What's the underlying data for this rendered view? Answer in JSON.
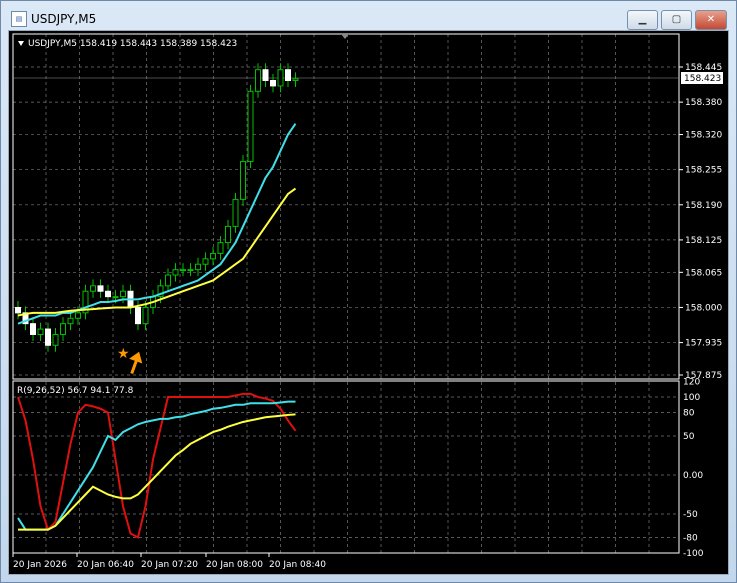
{
  "window": {
    "title": "USDJPY,M5",
    "buttons": [
      "minimize",
      "maximize",
      "close"
    ]
  },
  "chart_header": "USDJPY,M5  158.419 158.443 158.389 158.423",
  "current_price": "158.423",
  "price_axis": [
    "158.445",
    "158.380",
    "158.320",
    "158.255",
    "158.190",
    "158.125",
    "158.065",
    "158.000",
    "157.935",
    "157.875"
  ],
  "indicator": {
    "label": "R(9,26,52) 56.7 94.1 77.8",
    "axis": [
      "120",
      "100",
      "80",
      "50",
      "0.00",
      "-50",
      "-80",
      "-100"
    ]
  },
  "time_axis": [
    "20 Jan 2026",
    "20 Jan 06:40",
    "20 Jan 07:20",
    "20 Jan 08:00",
    "20 Jan 08:40"
  ],
  "colors": {
    "bull": "#00c000",
    "bear": "#ffffff",
    "ma_fast": "#40e0e8",
    "ma_slow": "#ffff40",
    "ind_red": "#e01010",
    "signal": "#ff9900"
  },
  "chart_data": {
    "type": "candlestick",
    "closes": [
      157.99,
      157.97,
      157.95,
      157.96,
      157.93,
      157.95,
      157.97,
      157.98,
      157.99,
      158.03,
      158.04,
      158.03,
      158.02,
      158.02,
      158.03,
      158.0,
      157.97,
      158.0,
      158.02,
      158.04,
      158.06,
      158.07,
      158.07,
      158.07,
      158.08,
      158.09,
      158.1,
      158.12,
      158.15,
      158.2,
      158.27,
      158.4,
      158.44,
      158.42,
      158.41,
      158.44,
      158.42,
      158.423
    ],
    "ma_fast": [
      157.97,
      157.975,
      157.98,
      157.985,
      157.985,
      157.985,
      157.99,
      157.99,
      157.995,
      158.0,
      158.005,
      158.01,
      158.01,
      158.012,
      158.015,
      158.015,
      158.015,
      158.018,
      158.02,
      158.025,
      158.03,
      158.035,
      158.04,
      158.045,
      158.05,
      158.06,
      158.07,
      158.08,
      158.1,
      158.12,
      158.15,
      158.18,
      158.21,
      158.24,
      158.26,
      158.29,
      158.32,
      158.34
    ],
    "ma_slow": [
      157.985,
      157.988,
      157.99,
      157.99,
      157.99,
      157.99,
      157.992,
      157.994,
      157.995,
      157.996,
      157.997,
      157.998,
      157.999,
      158.0,
      158.0,
      158.0,
      158.003,
      158.006,
      158.01,
      158.015,
      158.02,
      158.025,
      158.03,
      158.035,
      158.04,
      158.045,
      158.05,
      158.06,
      158.07,
      158.08,
      158.09,
      158.11,
      158.13,
      158.15,
      158.17,
      158.19,
      158.21,
      158.22
    ],
    "ind_red": [
      100,
      70,
      20,
      -40,
      -70,
      -60,
      -10,
      40,
      80,
      90,
      88,
      85,
      80,
      20,
      -40,
      -75,
      -80,
      -40,
      20,
      60,
      100,
      100,
      100,
      100,
      100,
      100,
      100,
      100,
      100,
      102,
      104,
      104,
      100,
      98,
      95,
      85,
      70,
      56.7
    ],
    "ind_cyan": [
      -55,
      -70,
      -70,
      -70,
      -70,
      -65,
      -50,
      -35,
      -20,
      -5,
      10,
      30,
      50,
      45,
      55,
      60,
      65,
      68,
      70,
      72,
      72,
      74,
      75,
      78,
      80,
      82,
      85,
      86,
      88,
      90,
      90,
      92,
      92,
      92,
      92,
      93,
      94,
      94.1
    ],
    "ind_yellow": [
      -70,
      -70,
      -70,
      -70,
      -70,
      -65,
      -55,
      -45,
      -35,
      -25,
      -15,
      -20,
      -25,
      -28,
      -30,
      -30,
      -25,
      -15,
      -5,
      5,
      15,
      25,
      32,
      40,
      45,
      50,
      55,
      58,
      62,
      65,
      68,
      70,
      72,
      74,
      75,
      76,
      77,
      77.8
    ],
    "price_range": [
      157.875,
      158.445
    ],
    "indicator_range": [
      -100,
      120
    ]
  }
}
